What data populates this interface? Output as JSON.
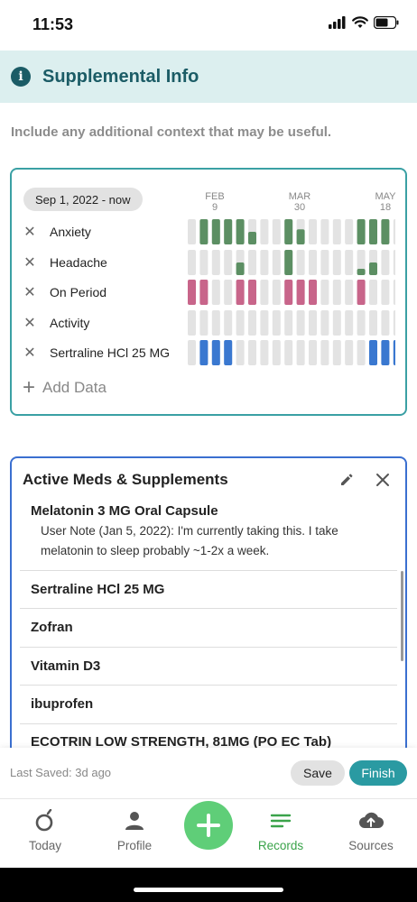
{
  "status_bar": {
    "time": "11:53"
  },
  "section": {
    "title": "Supplemental Info",
    "info_icon": "info-icon"
  },
  "subtitle": "Include any additional context that may be useful.",
  "tracker": {
    "date_range": "Sep 1, 2022 - now",
    "axis": [
      {
        "month": "FEB",
        "day": "9"
      },
      {
        "month": "MAR",
        "day": "30"
      },
      {
        "month": "MAY",
        "day": "18"
      }
    ],
    "rows": [
      {
        "label": "Anxiety",
        "color": "#5c8f63",
        "levels": [
          0,
          1,
          1,
          1,
          1,
          0.5,
          0,
          0,
          1,
          0.6,
          0,
          0,
          0,
          0,
          1,
          1,
          1,
          0
        ]
      },
      {
        "label": "Headache",
        "color": "#5c8f63",
        "levels": [
          0,
          0,
          0,
          0,
          0.5,
          0,
          0,
          0,
          1,
          0,
          0,
          0,
          0,
          0,
          0.25,
          0.5,
          0,
          0
        ]
      },
      {
        "label": "On Period",
        "color": "#c8658a",
        "levels": [
          1,
          1,
          0,
          0,
          1,
          1,
          0,
          0,
          1,
          1,
          1,
          0,
          0,
          0,
          1,
          0,
          0,
          0
        ]
      },
      {
        "label": "Activity",
        "color": "#3a78d0",
        "levels": [
          0,
          0,
          0,
          0,
          0,
          0,
          0,
          0,
          0,
          0,
          0,
          0,
          0,
          0,
          0,
          0,
          0,
          0
        ]
      },
      {
        "label": "Sertraline HCl 25 MG",
        "color": "#3a78d0",
        "levels": [
          0,
          1,
          1,
          1,
          0,
          0,
          0,
          0,
          0,
          0,
          0,
          0,
          0,
          0,
          0,
          1,
          1,
          1
        ]
      }
    ],
    "add_label": "Add Data"
  },
  "meds": {
    "title": "Active Meds & Supplements",
    "items": [
      {
        "name": "Melatonin 3 MG Oral Capsule",
        "note": "User Note (Jan 5, 2022): I'm currently taking this. I take melatonin to sleep probably ~1-2x a week."
      },
      {
        "name": "Sertraline HCl 25 MG"
      },
      {
        "name": "Zofran"
      },
      {
        "name": "Vitamin D3"
      },
      {
        "name": "ibuprofen"
      },
      {
        "name": "ECOTRIN LOW STRENGTH, 81MG (PO EC Tab)"
      }
    ]
  },
  "save_bar": {
    "last_saved": "Last Saved: 3d ago",
    "save_label": "Save",
    "finish_label": "Finish"
  },
  "tabs": [
    {
      "label": "Today",
      "icon": "today-icon"
    },
    {
      "label": "Profile",
      "icon": "person-icon"
    },
    {
      "label": "Records",
      "icon": "records-icon",
      "active": true
    },
    {
      "label": "Sources",
      "icon": "cloud-upload-icon"
    }
  ],
  "colors": {
    "accent": "#2a9aa2",
    "header_bg": "#dcefef",
    "active_tab": "#3aa34a",
    "fab": "#5fce78"
  }
}
